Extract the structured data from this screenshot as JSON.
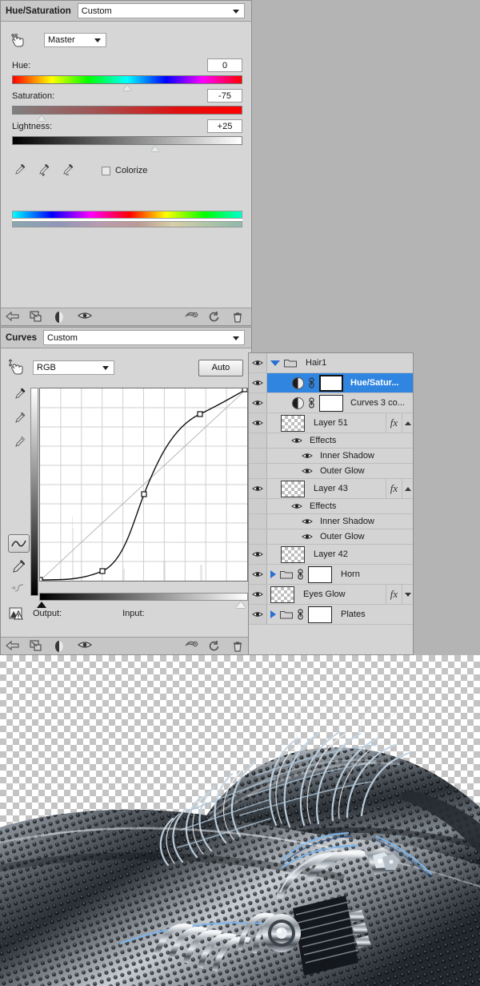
{
  "hue_saturation": {
    "title": "Hue/Saturation",
    "preset": "Custom",
    "target_channel": "Master",
    "targeted_adjust_icon": "hand-target-icon",
    "rows": [
      {
        "label": "Hue:",
        "value": "0",
        "thumb_pct": 50
      },
      {
        "label": "Saturation:",
        "value": "-75",
        "thumb_pct": 13
      },
      {
        "label": "Lightness:",
        "value": "+25",
        "thumb_pct": 62
      }
    ],
    "eyedroppers": [
      "eyedropper-icon",
      "eyedropper-plus-icon",
      "eyedropper-minus-icon"
    ],
    "colorize_label": "Colorize",
    "colorize_checked": false,
    "footer_icons": [
      "return-arrow-icon",
      "clip-to-layer-icon",
      "view-previous-state-icon",
      "toggle-visibility-icon",
      "reset-adjustment-icon",
      "refresh-icon",
      "delete-icon"
    ]
  },
  "curves": {
    "title": "Curves",
    "preset": "Custom",
    "channel": "RGB",
    "auto_label": "Auto",
    "targeted_adjust_icon": "hand-target-icon",
    "tools": [
      "eyedropper-black-icon",
      "eyedropper-gray-icon",
      "eyedropper-white-icon",
      "curve-pencil-tool-icon",
      "pencil-tool-icon",
      "smooth-curve-icon"
    ],
    "curve_tool_selected": "curve-pencil-tool-icon",
    "output_label": "Output:",
    "output_value": "",
    "input_label": "Input:",
    "input_value": "",
    "clipping_warning_icon": "clipping-warning-icon",
    "black_point_pct": 0,
    "white_point_pct": 100,
    "footer_icons": [
      "return-arrow-icon",
      "clip-to-layer-icon",
      "view-previous-state-icon",
      "toggle-visibility-icon",
      "reset-adjustment-icon",
      "refresh-icon",
      "delete-icon"
    ],
    "chart_data": {
      "type": "line",
      "title": "Curves RGB",
      "xlabel": "Input",
      "ylabel": "Output",
      "xlim": [
        0,
        255
      ],
      "ylim": [
        0,
        255
      ],
      "grid": true,
      "grid_divisions": 10,
      "series": [
        {
          "name": "RGB curve",
          "control_points": [
            {
              "input": 0,
              "output": 0
            },
            {
              "input": 77,
              "output": 12
            },
            {
              "input": 150,
              "output": 115
            },
            {
              "input": 197,
              "output": 205
            },
            {
              "input": 255,
              "output": 255
            }
          ]
        },
        {
          "name": "baseline diagonal",
          "control_points": [
            {
              "input": 0,
              "output": 0
            },
            {
              "input": 255,
              "output": 255
            }
          ]
        }
      ]
    }
  },
  "layers": {
    "rows": [
      {
        "kind": "group",
        "name": "Hair1",
        "visible": true,
        "expanded": true,
        "selected": false,
        "indent": 0,
        "has_folder": true,
        "has_mask": false,
        "has_fx": false
      },
      {
        "kind": "adjust",
        "name": "Hue/Satur...",
        "visible": true,
        "selected": true,
        "indent": 1,
        "adjust_icon": "half-circle-adjustment-icon",
        "linked": true,
        "has_mask": true,
        "has_fx": false
      },
      {
        "kind": "adjust",
        "name": "Curves 3 co...",
        "visible": true,
        "selected": false,
        "indent": 1,
        "adjust_icon": "half-circle-adjustment-icon",
        "linked": true,
        "has_mask": true,
        "has_fx": false
      },
      {
        "kind": "pixel",
        "name": "Layer 51",
        "visible": true,
        "selected": false,
        "indent": 1,
        "has_fx": true,
        "fx_expanded": true
      },
      {
        "kind": "effects-header",
        "name": "Effects",
        "visible": true,
        "indent": 2
      },
      {
        "kind": "effect",
        "name": "Inner Shadow",
        "visible": true,
        "indent": 3
      },
      {
        "kind": "effect",
        "name": "Outer Glow",
        "visible": true,
        "indent": 3
      },
      {
        "kind": "pixel",
        "name": "Layer 43",
        "visible": true,
        "selected": false,
        "indent": 1,
        "has_fx": true,
        "fx_expanded": true
      },
      {
        "kind": "effects-header",
        "name": "Effects",
        "visible": true,
        "indent": 2
      },
      {
        "kind": "effect",
        "name": "Inner Shadow",
        "visible": true,
        "indent": 3
      },
      {
        "kind": "effect",
        "name": "Outer Glow",
        "visible": true,
        "indent": 3
      },
      {
        "kind": "pixel",
        "name": "Layer 42",
        "visible": true,
        "selected": false,
        "indent": 1,
        "has_fx": false
      },
      {
        "kind": "group",
        "name": "Horn",
        "visible": true,
        "expanded": false,
        "selected": false,
        "indent": 0,
        "has_folder": true,
        "has_mask": true,
        "has_fx": false
      },
      {
        "kind": "pixel",
        "name": "Eyes Glow",
        "visible": true,
        "selected": false,
        "indent": 0,
        "has_fx": true,
        "fx_expanded": false
      },
      {
        "kind": "group",
        "name": "Plates",
        "visible": true,
        "expanded": false,
        "selected": false,
        "indent": 0,
        "has_folder": true,
        "has_mask": true,
        "has_fx": false
      }
    ]
  },
  "colors": {
    "panel_bg": "#d6d6d6",
    "panel_head": "#c8c8c8",
    "selection_blue": "#2f85e0",
    "canvas_checker": "#c4c4c4",
    "app_bg": "#b4b4b4"
  }
}
